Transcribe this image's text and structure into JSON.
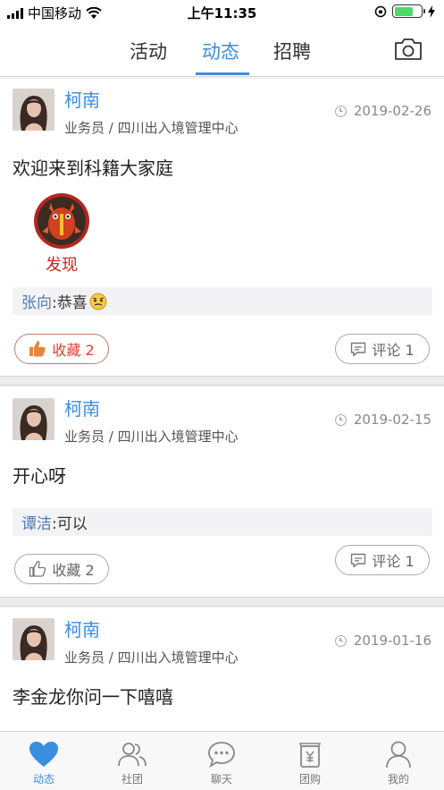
{
  "status_bar": {
    "carrier": "中国移动",
    "time": "上午11:35"
  },
  "top_tabs": [
    {
      "label": "活动",
      "active": false
    },
    {
      "label": "动态",
      "active": true
    },
    {
      "label": "招聘",
      "active": false
    }
  ],
  "accent_color": "#3b8de0",
  "posts": [
    {
      "author": "柯南",
      "role": "业务员 / 四川出入境管理中心",
      "date": "2019-02-26",
      "text": "欢迎来到科籍大家庭",
      "attachment_caption": "发现",
      "comment": {
        "author": "张向",
        "text": ":恭喜"
      },
      "favorite_label": "收藏 2",
      "favorite_active": true,
      "comment_label": "评论 1"
    },
    {
      "author": "柯南",
      "role": "业务员 / 四川出入境管理中心",
      "date": "2019-02-15",
      "text": "开心呀",
      "comment": {
        "author": "谭洁",
        "text": ":可以"
      },
      "favorite_label": "收藏 2",
      "favorite_active": false,
      "comment_label": "评论 1"
    },
    {
      "author": "柯南",
      "role": "业务员 / 四川出入境管理中心",
      "date": "2019-01-16",
      "text": "李金龙你问一下嘻嘻"
    }
  ],
  "bottom_tabs": [
    {
      "label": "动态",
      "icon": "heart-icon",
      "active": true
    },
    {
      "label": "社团",
      "icon": "group-icon",
      "active": false
    },
    {
      "label": "聊天",
      "icon": "chat-icon",
      "active": false
    },
    {
      "label": "团购",
      "icon": "shopping-bag-icon",
      "active": false
    },
    {
      "label": "我的",
      "icon": "person-icon",
      "active": false
    }
  ]
}
